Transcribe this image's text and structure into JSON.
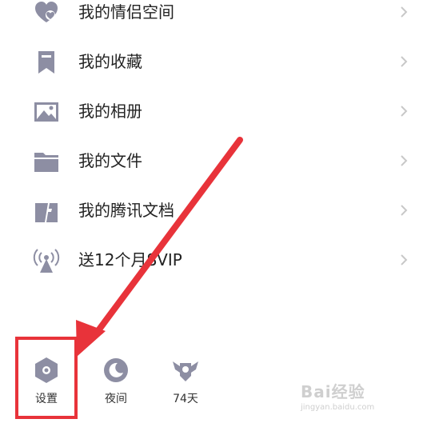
{
  "menu": {
    "items": [
      {
        "label": "我的情侣空间",
        "icon": "couple-heart-icon"
      },
      {
        "label": "我的收藏",
        "icon": "bookmark-icon"
      },
      {
        "label": "我的相册",
        "icon": "photo-album-icon"
      },
      {
        "label": "我的文件",
        "icon": "folder-icon"
      },
      {
        "label": "我的腾讯文档",
        "icon": "tencent-docs-icon"
      },
      {
        "label": "送12个月SVIP",
        "icon": "broadcast-signal-icon"
      }
    ],
    "chevron_icon": "chevron-right-icon"
  },
  "bottom_bar": {
    "settings": {
      "label": "设置",
      "icon": "hexagon-settings-icon"
    },
    "night": {
      "label": "夜间",
      "icon": "moon-icon"
    },
    "days": {
      "label": "74天",
      "icon": "winged-badge-icon"
    }
  },
  "annotation": {
    "highlight_color": "#e8333a",
    "arrow_color": "#e8333a"
  },
  "watermark": {
    "brand": "Bai经验",
    "url": "jingyan.baidu.com"
  },
  "colors": {
    "icon_gray": "#8d8ea3",
    "text": "#222222",
    "chevron": "#c8c8c8"
  }
}
